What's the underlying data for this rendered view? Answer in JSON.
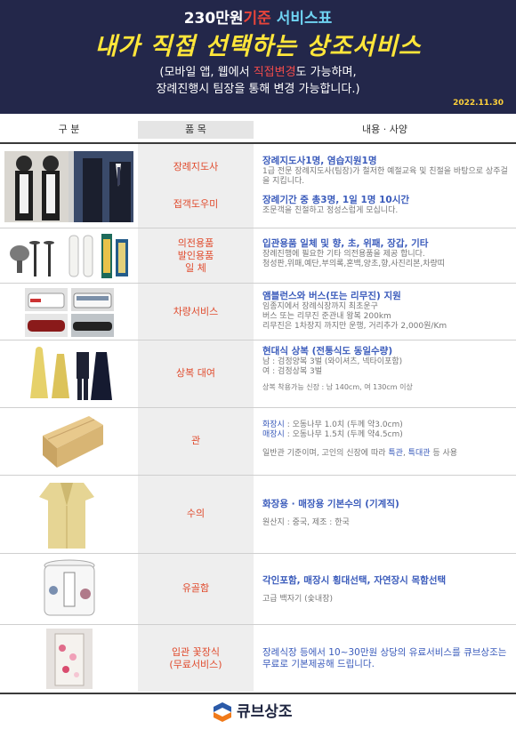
{
  "header": {
    "line1_prefix": "230만원",
    "line1_red": "기준",
    "line1_cyan": " 서비스표",
    "title": "내가 직접 선택하는 상조서비스",
    "sub1_a": "(모바일 앱, 웹에서 ",
    "sub1_red": "직접변경",
    "sub1_b": "도 가능하며,",
    "sub2": "장례진행시 팀장을 통해 변경 가능합니다.)",
    "date": "2022.11.30"
  },
  "columns": {
    "c1": "구  분",
    "c2": "품  목",
    "c3": "내용 · 사양"
  },
  "rows": [
    {
      "item_a": "장례지도사",
      "item_b": "접객도우미",
      "title_a": "장례지도사1명, 염습지원1명",
      "desc_a": "1급 전문 장례지도사(팀장)가 철저한 예절교육 및 친절을 바탕으로 상주걸을 지킵니다.",
      "title_b": "장례기간 중 총3명, 1일 1명 10시간",
      "desc_b": "조문객을 친절하고 정성스럽게 모십니다."
    },
    {
      "item_l1": "의전용품",
      "item_l2": "발인용품",
      "item_l3": "일      체",
      "title": "입관용품 일체 및 향, 초, 위패, 장갑, 기타",
      "desc1": "장례진행에 필요한 기타 의전용품을 제공 합니다.",
      "desc2": "청성판,위패,예단,부의록,혼백,양초,향,사진리본,차량띠"
    },
    {
      "item": "차량서비스",
      "title": "앰블런스와 버스(또는 리무진) 지원",
      "desc1": "임종지에서 장례식장까지 최초운구",
      "desc2": "버스 또는 리무진 준관내 왕복 200km",
      "desc3": "리무진은 1차장지 까지만 운행, 거리추가 2,000원/Km"
    },
    {
      "item": "상복 대여",
      "title": "현대식 상복 (전통식도 동일수량)",
      "desc1": "남 : 검정양복 3벌 (와이셔츠, 넥타이포함)",
      "desc2": "여 : 검정상복 3벌",
      "desc3": "상복 착용가능 신장 : 남 140cm, 여 130cm 이상"
    },
    {
      "item": "관",
      "l1_label": "화장시",
      "l1_rest": " : 오동나무 1.0치 (두께 약3.0cm)",
      "l2_label": "매장시",
      "l2_rest": " : 오동나무 1.5치 (두께 약4.5cm)",
      "l3_a": "일반관 기준이며, 고인의 신장에 따라 ",
      "l3_hl1": "특관",
      "l3_b": ", ",
      "l3_hl2": "특대관",
      "l3_c": " 등 사용"
    },
    {
      "item": "수의",
      "title": "화장용  ·  매장용 기본수의 (기계직)",
      "desc": "원산지 : 중국, 제조 : 한국"
    },
    {
      "item": "유골함",
      "title": "각인포함, 매장시 횡대선택, 자연장시 목함선택",
      "desc": "고급 백자기 (숯내장)"
    },
    {
      "item_l1": "입관 꽃장식",
      "item_l2": "(무료서비스)",
      "title": "장례식장 등에서 10~30만원 상당의 유료서비스를 큐브상조는 무료로 기본제공해 드립니다."
    }
  ],
  "footer": {
    "brand": "큐브상조"
  },
  "colors": {
    "header_bg": "#23274a",
    "title_yellow": "#ffe63a",
    "item_red": "#e04a2c",
    "content_blue": "#3a5bbb"
  }
}
